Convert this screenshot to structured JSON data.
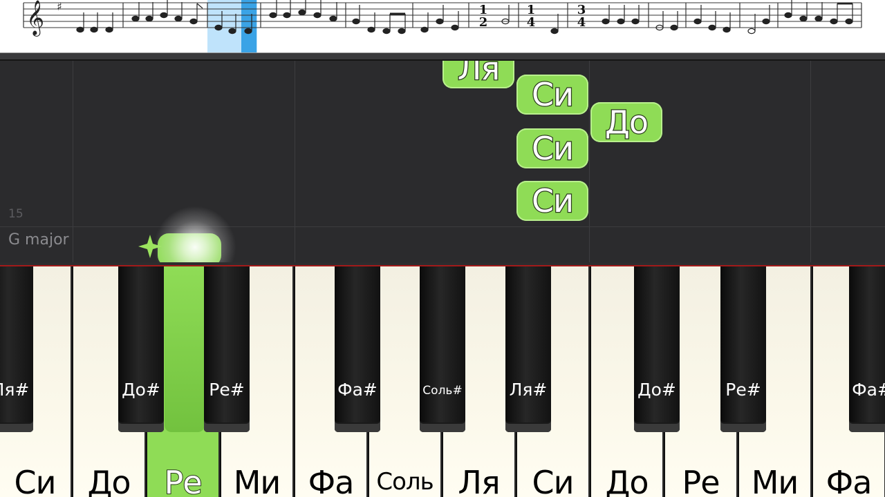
{
  "sheet": {
    "time_signatures": [
      {
        "top": "1",
        "bottom": "2"
      },
      {
        "top": "1",
        "bottom": "4"
      },
      {
        "top": "3",
        "bottom": "4"
      }
    ],
    "highlight_color": "#bfe3fb",
    "playhead_color": "#3aa3e6"
  },
  "roll": {
    "bar_number": "15",
    "key_label": "G major",
    "falling_notes": [
      {
        "name": "Ля"
      },
      {
        "name": "Си"
      },
      {
        "name": "До"
      },
      {
        "name": "Си"
      },
      {
        "name": "Си"
      }
    ],
    "note_color": "#8fdc56"
  },
  "piano": {
    "white_keys": [
      {
        "label": "Си",
        "active": false
      },
      {
        "label": "До",
        "active": false
      },
      {
        "label": "Ре",
        "active": true
      },
      {
        "label": "Ми",
        "active": false
      },
      {
        "label": "Фа",
        "active": false
      },
      {
        "label": "Соль",
        "active": false
      },
      {
        "label": "Ля",
        "active": false
      },
      {
        "label": "Си",
        "active": false
      },
      {
        "label": "До",
        "active": false
      },
      {
        "label": "Ре",
        "active": false
      },
      {
        "label": "Ми",
        "active": false
      },
      {
        "label": "Фа",
        "active": false
      }
    ],
    "black_keys": [
      {
        "label": "Ля#"
      },
      {
        "label": "До#"
      },
      {
        "label": "Ре#"
      },
      {
        "label": "Фа#"
      },
      {
        "label": "Соль#"
      },
      {
        "label": "Ля#"
      },
      {
        "label": "До#"
      },
      {
        "label": "Ре#"
      },
      {
        "label": "Фа#"
      }
    ],
    "active_color": "#8fdc56"
  }
}
